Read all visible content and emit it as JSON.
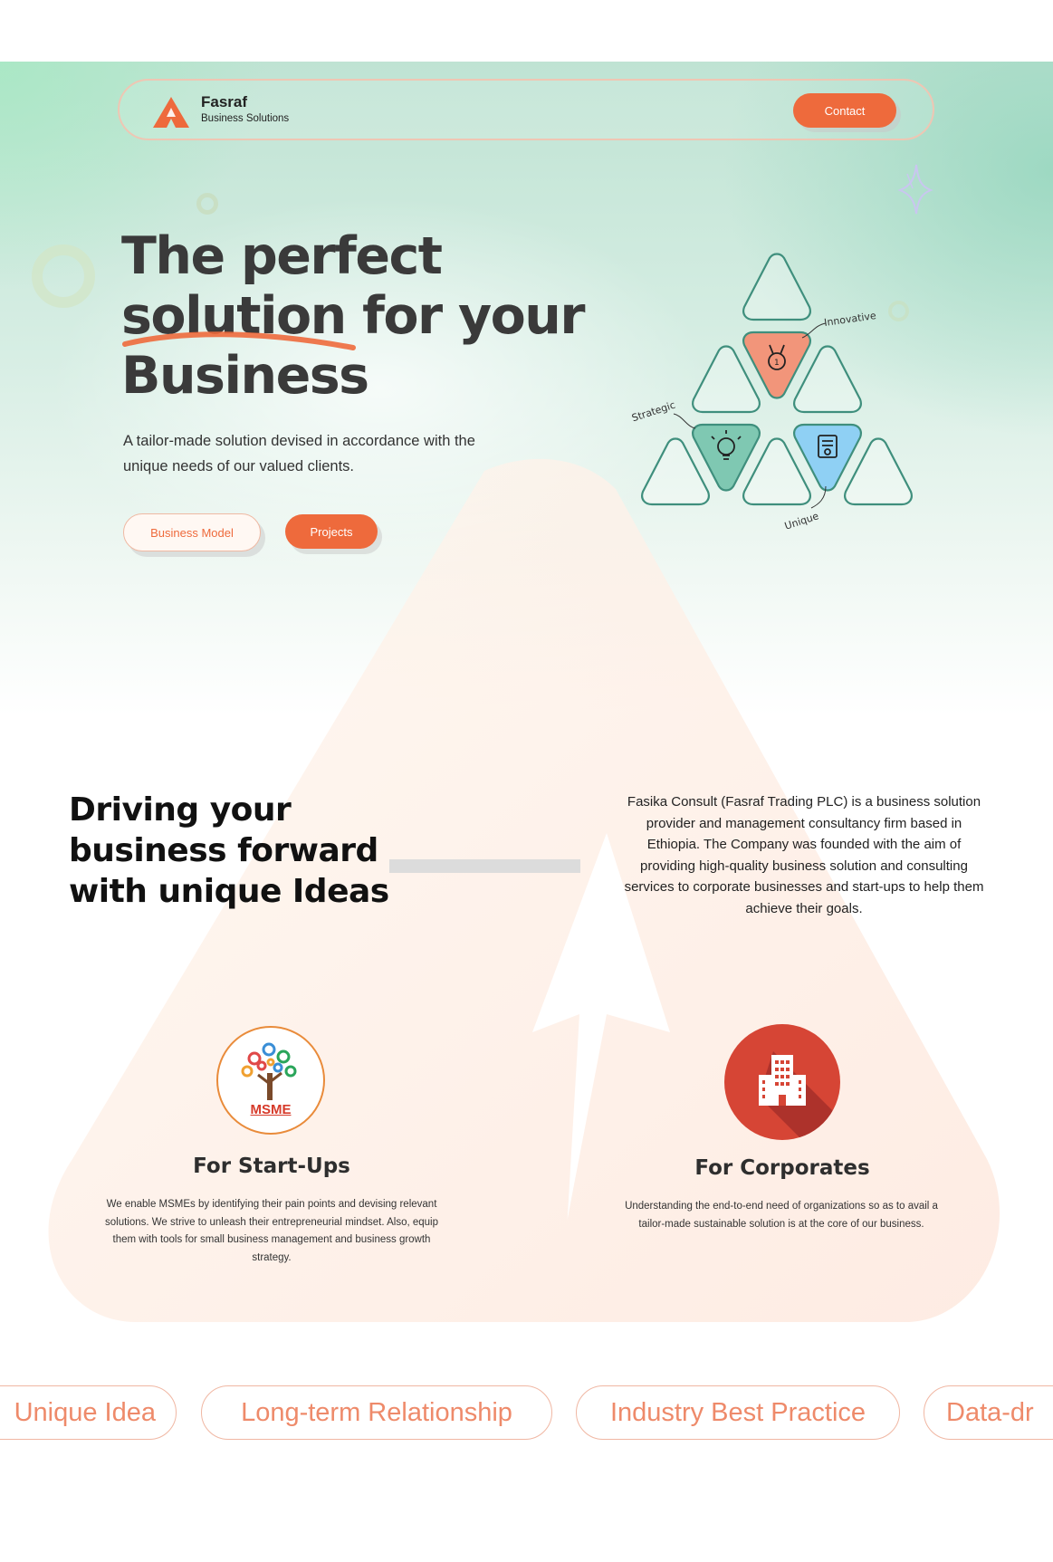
{
  "nav": {
    "brand_name": "Fasraf",
    "brand_sub": "Business Solutions",
    "contact_label": "Contact"
  },
  "hero": {
    "title_lines": [
      "The perfect",
      "solution for your",
      "Business"
    ],
    "subtitle_line1": "A tailor-made solution devised in accordance with the",
    "subtitle_line2": "unique needs of our valued clients.",
    "btn_business_model": "Business Model",
    "btn_projects": "Projects",
    "labels": {
      "innovative": "Innovative",
      "strategic": "Strategic",
      "unique": "Unique"
    }
  },
  "about": {
    "title_lines": [
      "Driving your",
      "business forward",
      "with unique Ideas"
    ],
    "text": "Fasika Consult (Fasraf Trading PLC) is a business solution provider and management consultancy firm based in Ethiopia. The Company was founded with the aim of providing high-quality business solution and consulting services to corporate businesses and start-ups to help them achieve their goals."
  },
  "cards": [
    {
      "title": "For Start-Ups",
      "logo_text": "MSME",
      "text": "We enable MSMEs by identifying their pain points and devising relevant solutions. We strive to unleash their entrepreneurial mindset. Also, equip them with tools for small business management and business growth strategy."
    },
    {
      "title": "For Corporates",
      "text": "Understanding the end-to-end need of organizations so as to avail a tailor-made sustainable solution is at the core of our business."
    }
  ],
  "values": [
    "Unique Idea",
    "Long-term Relationship",
    "Industry Best Practice",
    "Data-dr"
  ],
  "colors": {
    "accent": "#ee6a3c",
    "mint": "#bfe3d3",
    "teal_stroke": "#3f8f7d",
    "salmon": "#f2957a",
    "teal_fill": "#7fc8b2",
    "blue_fill": "#8fd0f4"
  }
}
